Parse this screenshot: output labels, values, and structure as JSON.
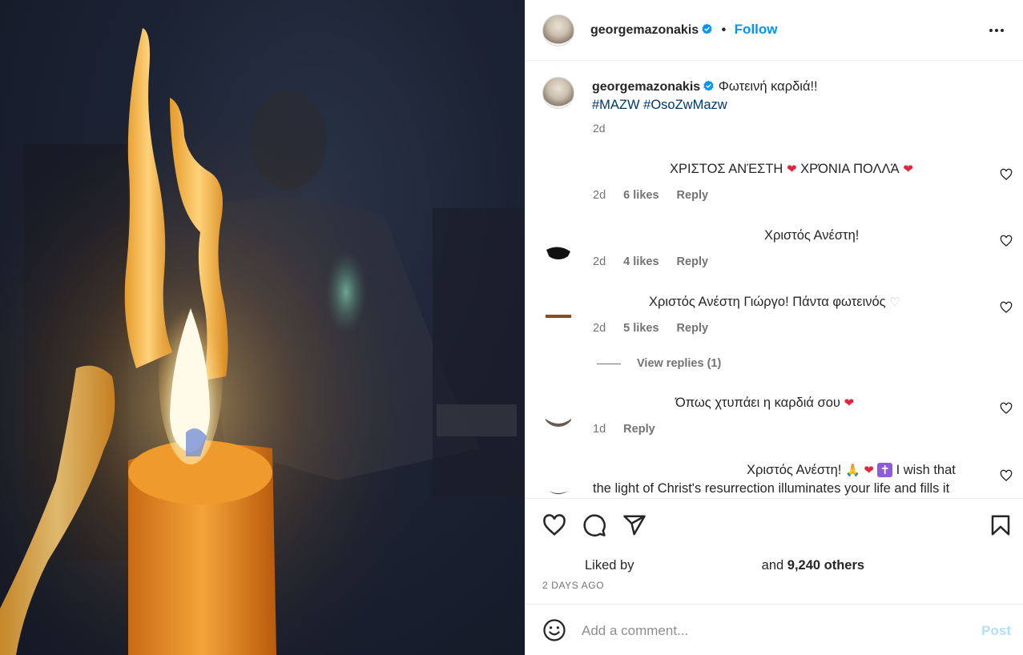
{
  "post": {
    "author": "georgemazonakis",
    "follow_label": "Follow",
    "separator": "•",
    "more_icon": "more-horizontal-icon",
    "caption": {
      "username": "georgemazonakis",
      "text": "Φωτεινή καρδιά!!",
      "hashtags": "#MAZW #OsoZwMazw",
      "time": "2d"
    }
  },
  "comments": [
    {
      "text": "ΧΡΙΣΤΟΣ ΑΝΈΣΤΗ",
      "emoji1": "❤",
      "text2": "ΧΡΌΝΙΑ ΠΟΛΛΆ",
      "emoji2": "❤",
      "time": "2d",
      "likes": "6 likes",
      "reply": "Reply"
    },
    {
      "text": "Χριστός Ανέστη!",
      "time": "2d",
      "likes": "4 likes",
      "reply": "Reply"
    },
    {
      "text": "Χριστός Ανέστη Γιώργο! Πάντα φωτεινός",
      "emoji1": "♡",
      "time": "2d",
      "likes": "5 likes",
      "reply": "Reply",
      "view_replies": "View replies (1)"
    },
    {
      "text": "Όπως χτυπάει η καρδιά σου",
      "emoji1": "❤",
      "time": "1d",
      "reply": "Reply"
    },
    {
      "text": "Χριστός Ανέστη!",
      "emoji1": "🙏",
      "emoji2": "❤",
      "emoji3": "✝",
      "text2": "I wish that",
      "text3": "the light of Christ's resurrection illuminates your life and fills it"
    }
  ],
  "actions": {
    "liked_by_prefix": "Liked by",
    "liked_by_suffix": "and",
    "others": "9,240 others",
    "date": "2 DAYS AGO"
  },
  "comment_box": {
    "placeholder": "Add a comment...",
    "post_label": "Post"
  },
  "colors": {
    "link_blue": "#0095f6",
    "hashtag": "#00376b",
    "muted": "#737373",
    "post_disabled": "#b2dffc",
    "heart_red": "#e0263b"
  }
}
